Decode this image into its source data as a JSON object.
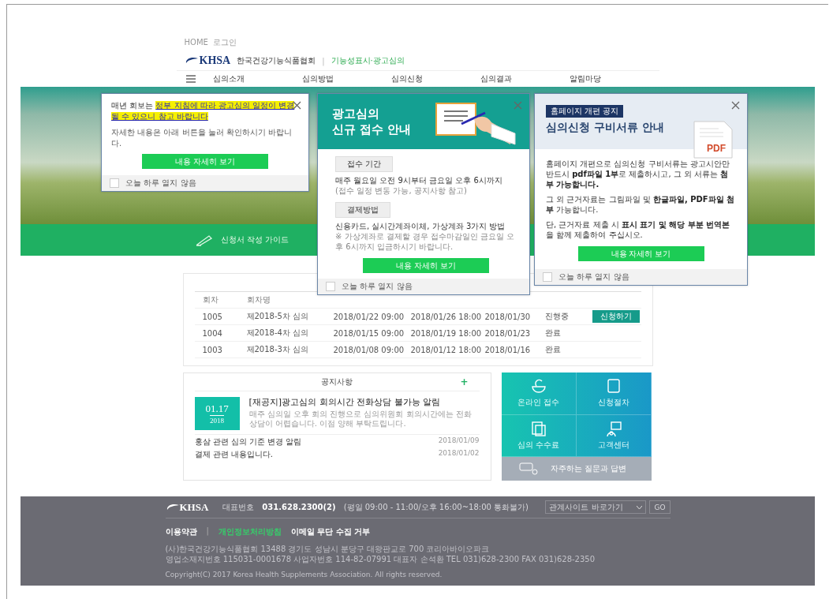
{
  "breadcrumb": [
    "HOME",
    "로그인"
  ],
  "header": {
    "logo": "KHSA",
    "org_name": "한국건강기능식품협회",
    "divider": "|",
    "service_name": "기능성표시·광고심의"
  },
  "nav": [
    "심의소개",
    "심의방법",
    "심의신청",
    "심의결과",
    "알림마당"
  ],
  "hero": {
    "bar_label": "신청서 작성 가이드"
  },
  "schedule": {
    "columns": [
      "회차",
      "회차명"
    ],
    "rows": [
      {
        "cells": [
          "1005",
          "제2018-5차 심의",
          "2018/01/22 09:00",
          "2018/01/26 18:00",
          "2018/01/30",
          "진행중"
        ],
        "action": "신청하기"
      },
      {
        "cells": [
          "1004",
          "제2018-4차 심의",
          "2018/01/15 09:00",
          "2018/01/19 18:00",
          "2018/01/23",
          "완료"
        ]
      },
      {
        "cells": [
          "1003",
          "제2018-3차 심의",
          "2018/01/08 09:00",
          "2018/01/12 18:00",
          "2018/01/16",
          "완료"
        ]
      }
    ]
  },
  "notices": {
    "title": "공지사항",
    "more": "+",
    "featured": {
      "day": "01.17",
      "year": "2018",
      "title": "[재공지]광고심의 회의시간 전화상담 불가능 알림",
      "summary": "매주 심의일 오후 회의 진행으로 심의위원회 회의시간에는 전화 상담이 어렵습니다. 이점 양해 부탁드립니다."
    },
    "items": [
      {
        "title": "홍삼 관련 심의 기준 변경 알림",
        "date": "2018/01/09"
      },
      {
        "title": "결제 관련 내용입니다.",
        "date": "2018/01/02"
      }
    ]
  },
  "quick_menu": {
    "items": [
      "온라인 접수",
      "신청절차",
      "심의 수수료",
      "고객센터"
    ],
    "faq": "자주하는 질문과 답변"
  },
  "footer": {
    "logo": "KHSA",
    "phone_label": "대표번호",
    "phone": "031.628.2300(2)",
    "hours": "(평일 09:00 - 11:00/오후 16:00~18:00 통화불가)",
    "site_select": "관계사이트 바로가기",
    "go": "GO",
    "links": [
      {
        "label": "이용약관",
        "kind": "plain"
      },
      {
        "label": "|",
        "kind": "separator"
      },
      {
        "label": "개인정보처리방침",
        "kind": "highlight"
      },
      {
        "label": "이메일 무단 수집 거부",
        "kind": "bold"
      }
    ],
    "address_lines": [
      "(사)한국건강기능식품협회   13488 경기도 성남시 분당구 대왕판교로 700 코리아바이오파크",
      "영업소재지번호 115031-0001678   사업자번호 114-82-07991   대표자 손석환   TEL 031)628-2300   FAX 031)628-2350"
    ],
    "copyright": "Copyright(C) 2017 Korea Health Supplements Association. All rights reserved."
  },
  "popups": [
    {
      "kind": "notice",
      "text_lead": "매년 회보는 ",
      "text_highlight": "정부 지침에 따라 광고심의 일정이 변경될 수 있으니 참고 바랍니다",
      "text_2": "자세한 내용은 아래 버튼을 눌러 확인하시기 바랍니다.",
      "button": "내용 자세히 보기",
      "dont_show_today": {
        "label": "오늘 하루 열지 않음",
        "checked": false
      }
    },
    {
      "kind": "intake",
      "title": "광고심의\n신규 접수 안내",
      "sections": [
        {
          "label": "접수 기간",
          "lines": [
            "매주 월요일 오전 9시부터 금요일 오후 6시까지",
            "(접수 일정 변동 가능, 공지사항 참고)"
          ]
        },
        {
          "label": "결제방법",
          "lines": [
            "신용카드, 실시간계좌이체, 가상계좌 3가지 방법",
            "※ 가상계좌로 결제할 경우 접수마감일인 금요일 오후 6시까지 입금하시기 바랍니다."
          ]
        }
      ],
      "button": "내용 자세히 보기",
      "dont_show_today": {
        "label": "오늘 하루 열지 않음",
        "checked": false
      }
    },
    {
      "kind": "documents",
      "badge": "홈페이지 개편 공지",
      "title": "심의신청 구비서류 안내",
      "file_badge": "PDF",
      "paragraphs": [
        "홈페이지 개편으로 심의신청 구비서류는 광고시안만 반드시 **pdf파일 1부**로 제출하시고, 그 외 서류는 **첨부 가능합니다.**",
        "그 외 근거자료는 그림파일 및 **한글파일, PDF파일 첨부** 가능합니다.",
        "단, 근거자료 제출 시 **표시 표기 및 해당 부분 번역본**을 함께 제출하여 주십시오."
      ],
      "button": "내용 자세히 보기",
      "dont_show_today": {
        "label": "오늘 하루 열지 않음",
        "checked": false
      }
    }
  ]
}
